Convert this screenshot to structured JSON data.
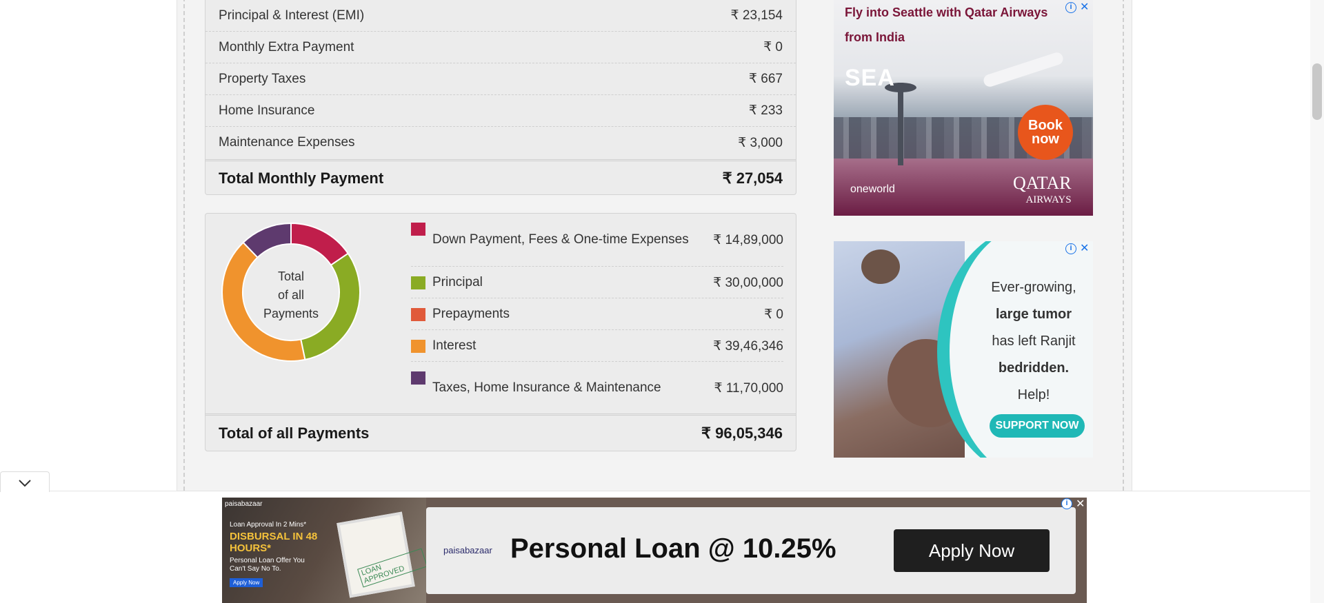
{
  "payment_breakdown": {
    "rows": [
      {
        "label": "Principal & Interest (EMI)",
        "value": "₹ 23,154"
      },
      {
        "label": "Monthly Extra Payment",
        "value": "₹ 0"
      },
      {
        "label": "Property Taxes",
        "value": "₹ 667"
      },
      {
        "label": "Home Insurance",
        "value": "₹ 233"
      },
      {
        "label": "Maintenance Expenses",
        "value": "₹ 3,000"
      }
    ],
    "total_label": "Total Monthly Payment",
    "total_value": "₹ 27,054"
  },
  "all_payments": {
    "donut_center": [
      "Total",
      "of all",
      "Payments"
    ],
    "items": [
      {
        "label": "Down Payment, Fees & One-time Expenses",
        "value": "₹ 14,89,000",
        "amount": 1489000,
        "color": "#c01e4b"
      },
      {
        "label": "Principal",
        "value": "₹ 30,00,000",
        "amount": 3000000,
        "color": "#8aab24"
      },
      {
        "label": "Prepayments",
        "value": "₹ 0",
        "amount": 0,
        "color": "#e05a3a"
      },
      {
        "label": "Interest",
        "value": "₹ 39,46,346",
        "amount": 3946346,
        "color": "#f0932d"
      },
      {
        "label": "Taxes, Home Insurance & Maintenance",
        "value": "₹ 11,70,000",
        "amount": 1170000,
        "color": "#5e3a6e"
      }
    ],
    "total_label": "Total of all Payments",
    "total_value": "₹ 96,05,346"
  },
  "ads": {
    "qatar": {
      "headline": "Fly into Seattle with Qatar Airways from India",
      "sea": "SEA",
      "book": "Book now",
      "oneworld": "oneworld",
      "brand": "QATAR",
      "brand_sub": "AIRWAYS"
    },
    "charity": {
      "line1": "Ever-growing,",
      "line2": "large tumor",
      "line3": "has left Ranjit",
      "line4": "bedridden.",
      "line5": "Help!",
      "button": "SUPPORT NOW"
    },
    "loan": {
      "brand_small": "paisabazaar",
      "approval": "Loan Approval In 2 Mins*",
      "disbursal": "DISBURSAL IN 48 HOURS*",
      "offer": "Personal Loan Offer You Can't Say No To.",
      "apply_small": "Apply Now",
      "stamp": "LOAN APPROVED",
      "brand": "paisabazaar",
      "headline": "Personal Loan @ 10.25%",
      "apply": "Apply Now"
    }
  },
  "icons": {
    "ad_info": "info-icon",
    "ad_close": "close-icon",
    "collapse": "chevron-down-icon"
  }
}
